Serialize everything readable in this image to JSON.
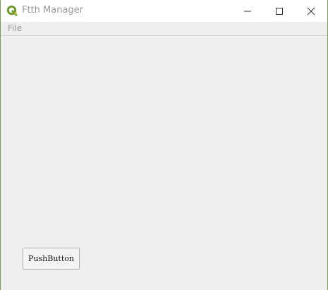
{
  "window": {
    "title": "Ftth Manager",
    "app_icon": "qgis-logo-icon",
    "controls": {
      "minimize": "minimize-icon",
      "maximize": "maximize-icon",
      "close": "close-icon"
    }
  },
  "menubar": {
    "items": [
      {
        "label": "File"
      }
    ]
  },
  "content": {
    "push_button_label": "PushButton"
  },
  "colors": {
    "title_text": "#9a9a9a",
    "window_bg": "#efefef",
    "titlebar_bg": "#ffffff",
    "app_icon": "#6d9a2e"
  }
}
